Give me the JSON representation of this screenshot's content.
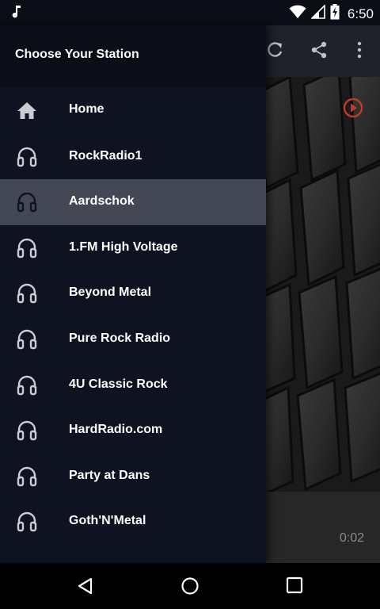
{
  "status_bar": {
    "time": "6:50",
    "icons": [
      "music-note-icon",
      "wifi-icon",
      "signal-icon",
      "battery-charging-icon"
    ]
  },
  "toolbar": {
    "icons": [
      "refresh-icon",
      "share-icon",
      "more-vert-icon"
    ]
  },
  "drawer": {
    "title": "Choose Your Station",
    "items": [
      {
        "label": "Home",
        "icon": "home-icon",
        "selected": false
      },
      {
        "label": "RockRadio1",
        "icon": "headphones-icon",
        "selected": false
      },
      {
        "label": "Aardschok",
        "icon": "headphones-icon",
        "selected": true
      },
      {
        "label": "1.FM High Voltage",
        "icon": "headphones-icon",
        "selected": false
      },
      {
        "label": "Beyond Metal",
        "icon": "headphones-icon",
        "selected": false
      },
      {
        "label": "Pure Rock Radio",
        "icon": "headphones-icon",
        "selected": false
      },
      {
        "label": "4U Classic Rock",
        "icon": "headphones-icon",
        "selected": false
      },
      {
        "label": "HardRadio.com",
        "icon": "headphones-icon",
        "selected": false
      },
      {
        "label": "Party at Dans",
        "icon": "headphones-icon",
        "selected": false
      },
      {
        "label": "Goth'N'Metal",
        "icon": "headphones-icon",
        "selected": false
      }
    ]
  },
  "player": {
    "elapsed": "0:02"
  },
  "nav_bar": {
    "icons": [
      "back-icon",
      "home-circle-icon",
      "recents-icon"
    ]
  },
  "colors": {
    "drawer_bg": "#0f1221",
    "selected_bg": "#444754",
    "accent": "#c0392b"
  }
}
